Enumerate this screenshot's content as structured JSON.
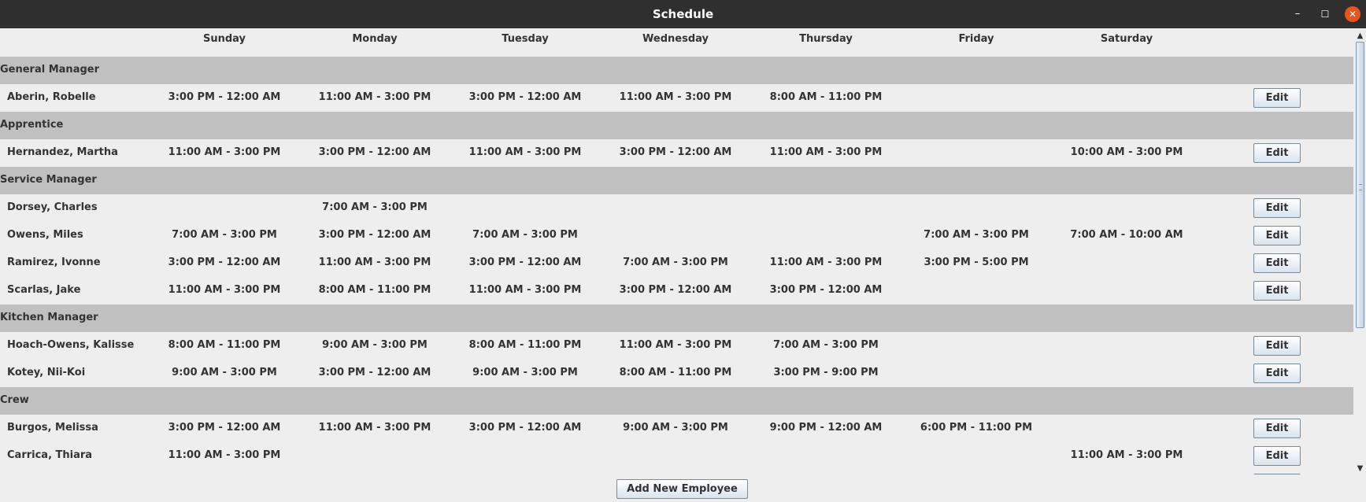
{
  "window": {
    "title": "Schedule",
    "min_glyph": "–",
    "max_glyph": "☐",
    "close_glyph": "✕"
  },
  "days": [
    "Sunday",
    "Monday",
    "Tuesday",
    "Wednesday",
    "Thursday",
    "Friday",
    "Saturday"
  ],
  "edit_label": "Edit",
  "groups": [
    {
      "name": "General Manager",
      "employees": [
        {
          "name": "Aberin, Robelle",
          "shifts": [
            "3:00 PM - 12:00 AM",
            "11:00 AM - 3:00 PM",
            "3:00 PM - 12:00 AM",
            "11:00 AM - 3:00 PM",
            "8:00 AM - 11:00 PM",
            "",
            ""
          ]
        }
      ]
    },
    {
      "name": "Apprentice",
      "employees": [
        {
          "name": "Hernandez, Martha",
          "shifts": [
            "11:00 AM - 3:00 PM",
            "3:00 PM - 12:00 AM",
            "11:00 AM - 3:00 PM",
            "3:00 PM - 12:00 AM",
            "11:00 AM - 3:00 PM",
            "",
            "10:00 AM - 3:00 PM"
          ]
        }
      ]
    },
    {
      "name": "Service Manager",
      "employees": [
        {
          "name": "Dorsey, Charles",
          "shifts": [
            "",
            "7:00 AM - 3:00 PM",
            "",
            "",
            "",
            "",
            ""
          ]
        },
        {
          "name": "Owens, Miles",
          "shifts": [
            "7:00 AM - 3:00 PM",
            "3:00 PM - 12:00 AM",
            "7:00 AM - 3:00 PM",
            "",
            "",
            "7:00 AM - 3:00 PM",
            "7:00 AM - 10:00 AM"
          ]
        },
        {
          "name": "Ramirez, Ivonne",
          "shifts": [
            "3:00 PM - 12:00 AM",
            "11:00 AM - 3:00 PM",
            "3:00 PM - 12:00 AM",
            "7:00 AM - 3:00 PM",
            "11:00 AM - 3:00 PM",
            "3:00 PM - 5:00 PM",
            ""
          ]
        },
        {
          "name": "Scarlas, Jake",
          "shifts": [
            "11:00 AM - 3:00 PM",
            "8:00 AM - 11:00 PM",
            "11:00 AM - 3:00 PM",
            "3:00 PM - 12:00 AM",
            "3:00 PM - 12:00 AM",
            "",
            ""
          ]
        }
      ]
    },
    {
      "name": "Kitchen Manager",
      "employees": [
        {
          "name": "Hoach-Owens, Kalisse",
          "shifts": [
            "8:00 AM - 11:00 PM",
            "9:00 AM - 3:00 PM",
            "8:00 AM - 11:00 PM",
            "11:00 AM - 3:00 PM",
            "7:00 AM - 3:00 PM",
            "",
            ""
          ]
        },
        {
          "name": "Kotey, Nii-Koi",
          "shifts": [
            "9:00 AM - 3:00 PM",
            "3:00 PM - 12:00 AM",
            "9:00 AM - 3:00 PM",
            "8:00 AM - 11:00 PM",
            "3:00 PM - 9:00 PM",
            "",
            ""
          ]
        }
      ]
    },
    {
      "name": "Crew",
      "employees": [
        {
          "name": "Burgos, Melissa",
          "shifts": [
            "3:00 PM - 12:00 AM",
            "11:00 AM - 3:00 PM",
            "3:00 PM - 12:00 AM",
            "9:00 AM - 3:00 PM",
            "9:00 PM - 12:00 AM",
            "6:00 PM - 11:00 PM",
            ""
          ]
        },
        {
          "name": "Carrica, Thiara",
          "shifts": [
            "11:00 AM - 3:00 PM",
            "",
            "",
            "",
            "",
            "",
            "11:00 AM - 3:00 PM"
          ]
        },
        {
          "name": "",
          "shifts": [
            "",
            "",
            "",
            "",
            "",
            "",
            ""
          ]
        }
      ]
    }
  ],
  "add_button_label": "Add New Employee",
  "scrollbar": {
    "position_fraction": 0.0,
    "visible_fraction": 0.68,
    "up_glyph": "▲",
    "down_glyph": "▼"
  },
  "colors": {
    "titlebar": "#2f2f2f",
    "close_button": "#e95420",
    "group_header": "#c0c0c0",
    "background": "#eeeeee"
  }
}
